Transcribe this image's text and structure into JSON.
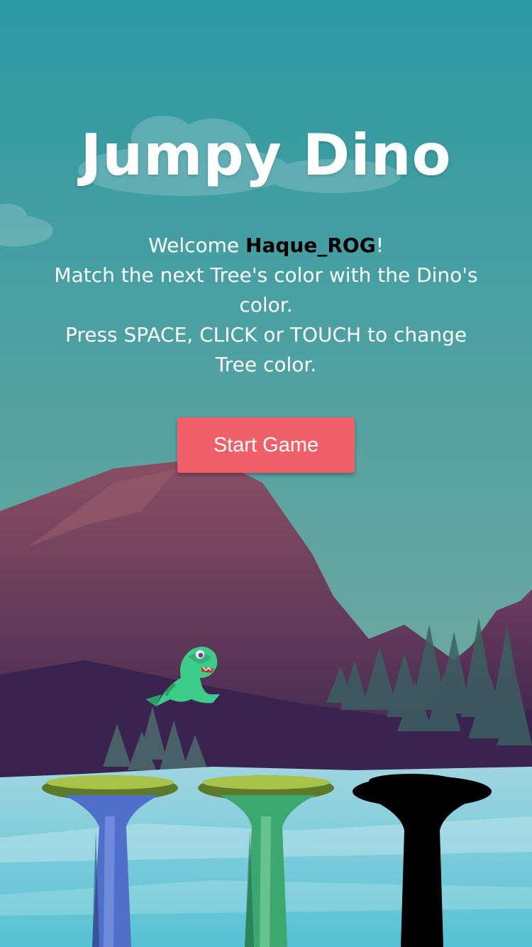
{
  "game": {
    "title": "Jumpy Dino",
    "welcome_prefix": "Welcome ",
    "player_name": "Haque_ROG",
    "welcome_suffix": "!",
    "instruction_1": "Match the next Tree's color with the Dino's color.",
    "instruction_2": "Press SPACE, CLICK or TOUCH to change Tree color.",
    "start_button_label": "Start Game"
  },
  "palette": {
    "sky_top": "#2c9aa3",
    "sky_bottom": "#78ab9e",
    "mountain": "#6a3a5a",
    "ground_ice": "#5fc9d8",
    "button": "#ef6069",
    "dino": "#3ecc8a"
  },
  "trees": [
    {
      "color": "blue",
      "hex": "#4f6fc9"
    },
    {
      "color": "green",
      "hex": "#3ca870"
    },
    {
      "color": "black",
      "hex": "#000000"
    }
  ]
}
